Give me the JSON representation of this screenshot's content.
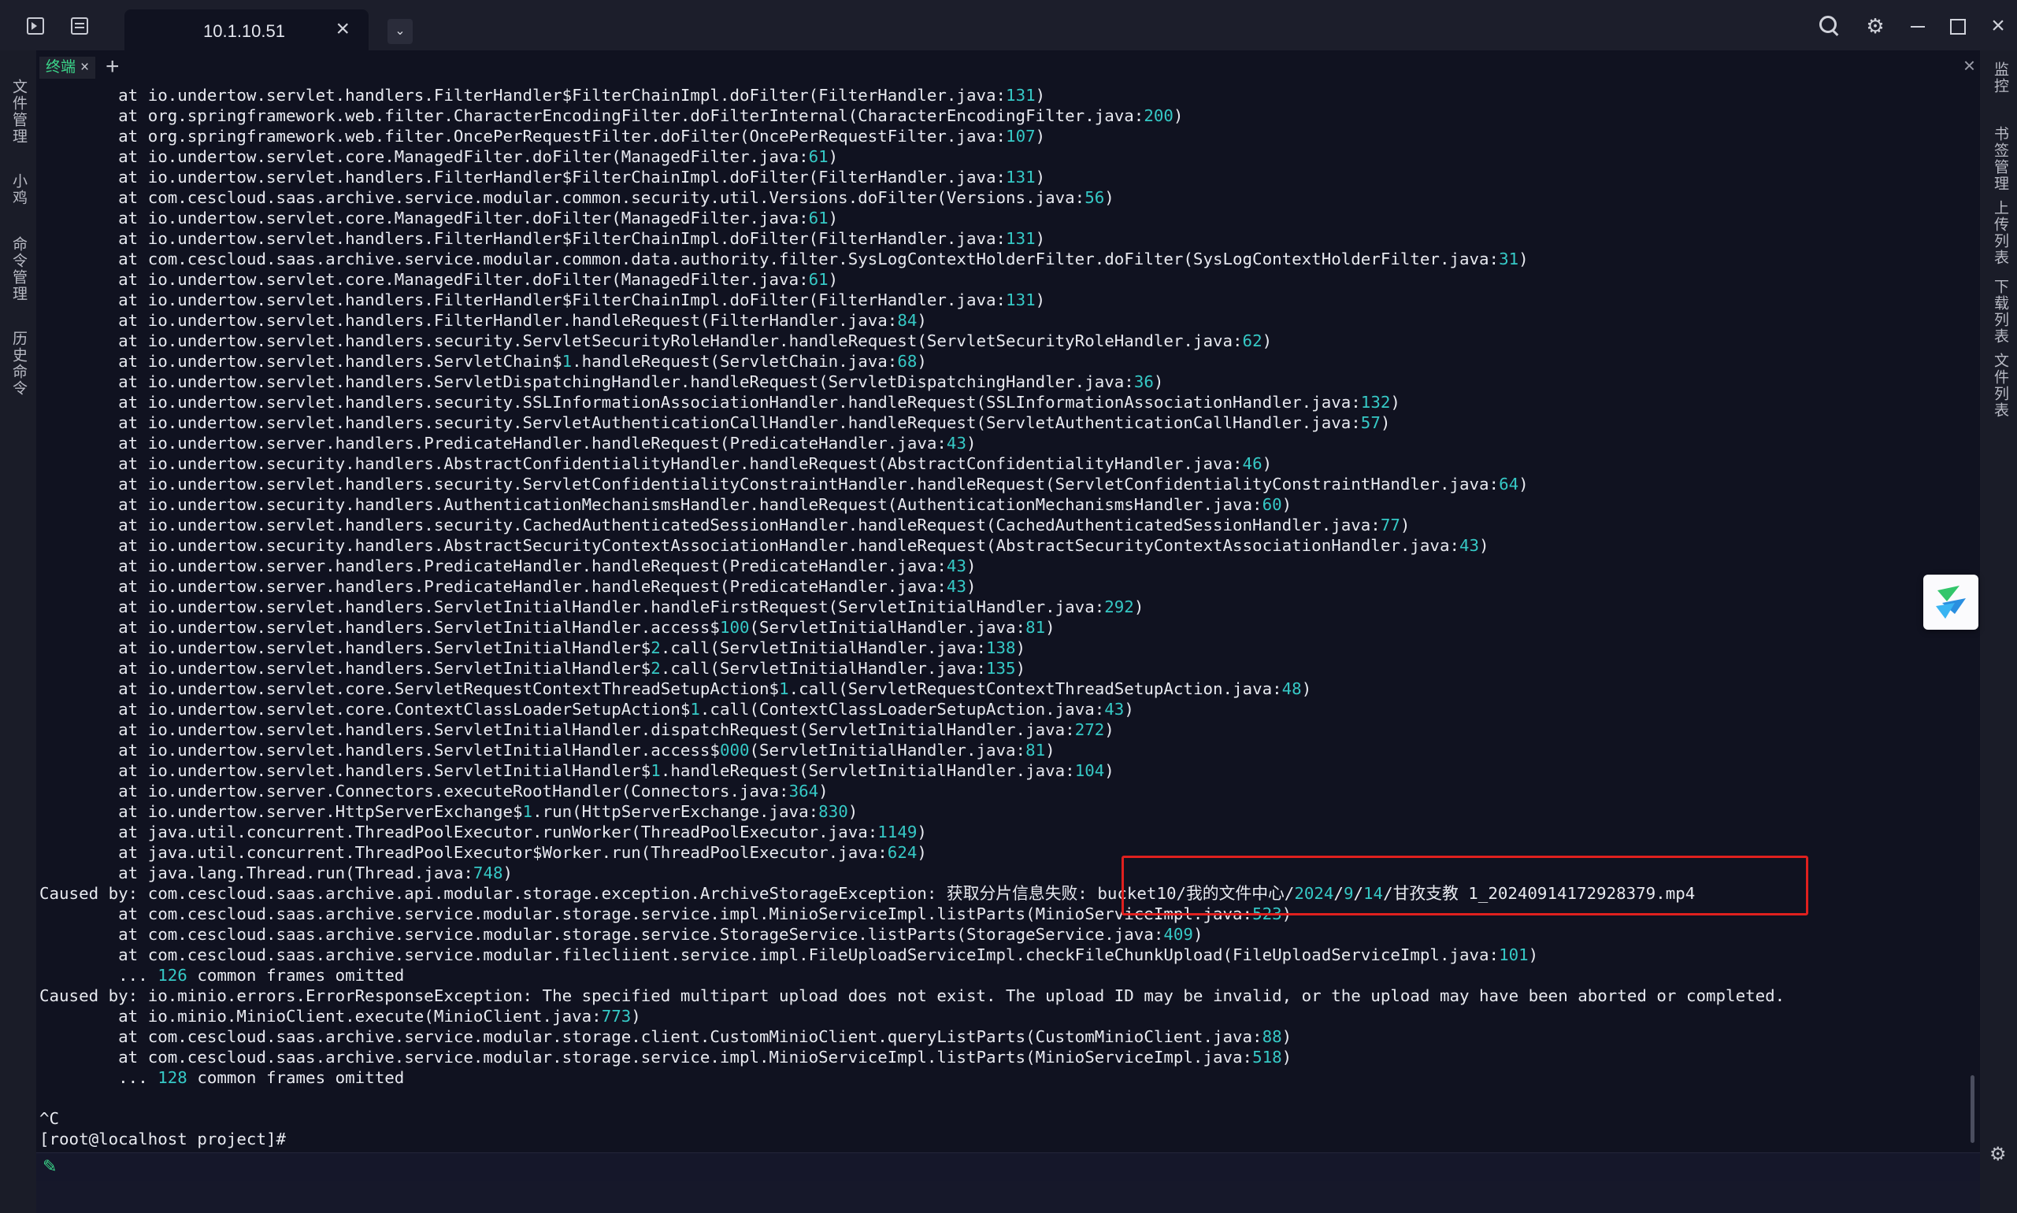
{
  "window": {
    "tab_title": "10.1.10.51"
  },
  "subtabs": {
    "terminal_tab_label": "终端"
  },
  "left_rail": [
    "文件管理",
    "小鸡",
    "命令管理",
    "历史命令"
  ],
  "right_rail": [
    "监控",
    "书签管理",
    "上传列表",
    "下载列表",
    "文件列表"
  ],
  "terminal": {
    "lines": [
      [
        [
          "        at io.undertow.servlet.handlers.FilterHandler$FilterChainImpl.doFilter(FilterHandler.java:",
          ""
        ],
        [
          "131",
          "n"
        ],
        [
          ")",
          ""
        ]
      ],
      [
        [
          "        at org.springframework.web.filter.CharacterEncodingFilter.doFilterInternal(CharacterEncodingFilter.java:",
          ""
        ],
        [
          "200",
          "n"
        ],
        [
          ")",
          ""
        ]
      ],
      [
        [
          "        at org.springframework.web.filter.OncePerRequestFilter.doFilter(OncePerRequestFilter.java:",
          ""
        ],
        [
          "107",
          "n"
        ],
        [
          ")",
          ""
        ]
      ],
      [
        [
          "        at io.undertow.servlet.core.ManagedFilter.doFilter(ManagedFilter.java:",
          ""
        ],
        [
          "61",
          "n"
        ],
        [
          ")",
          ""
        ]
      ],
      [
        [
          "        at io.undertow.servlet.handlers.FilterHandler$FilterChainImpl.doFilter(FilterHandler.java:",
          ""
        ],
        [
          "131",
          "n"
        ],
        [
          ")",
          ""
        ]
      ],
      [
        [
          "        at com.cescloud.saas.archive.service.modular.common.security.util.Versions.doFilter(Versions.java:",
          ""
        ],
        [
          "56",
          "n"
        ],
        [
          ")",
          ""
        ]
      ],
      [
        [
          "        at io.undertow.servlet.core.ManagedFilter.doFilter(ManagedFilter.java:",
          ""
        ],
        [
          "61",
          "n"
        ],
        [
          ")",
          ""
        ]
      ],
      [
        [
          "        at io.undertow.servlet.handlers.FilterHandler$FilterChainImpl.doFilter(FilterHandler.java:",
          ""
        ],
        [
          "131",
          "n"
        ],
        [
          ")",
          ""
        ]
      ],
      [
        [
          "        at com.cescloud.saas.archive.service.modular.common.data.authority.filter.SysLogContextHolderFilter.doFilter(SysLogContextHolderFilter.java:",
          ""
        ],
        [
          "31",
          "n"
        ],
        [
          ")",
          ""
        ]
      ],
      [
        [
          "        at io.undertow.servlet.core.ManagedFilter.doFilter(ManagedFilter.java:",
          ""
        ],
        [
          "61",
          "n"
        ],
        [
          ")",
          ""
        ]
      ],
      [
        [
          "        at io.undertow.servlet.handlers.FilterHandler$FilterChainImpl.doFilter(FilterHandler.java:",
          ""
        ],
        [
          "131",
          "n"
        ],
        [
          ")",
          ""
        ]
      ],
      [
        [
          "        at io.undertow.servlet.handlers.FilterHandler.handleRequest(FilterHandler.java:",
          ""
        ],
        [
          "84",
          "n"
        ],
        [
          ")",
          ""
        ]
      ],
      [
        [
          "        at io.undertow.servlet.handlers.security.ServletSecurityRoleHandler.handleRequest(ServletSecurityRoleHandler.java:",
          ""
        ],
        [
          "62",
          "n"
        ],
        [
          ")",
          ""
        ]
      ],
      [
        [
          "        at io.undertow.servlet.handlers.ServletChain$",
          ""
        ],
        [
          "1",
          "n"
        ],
        [
          ".handleRequest(ServletChain.java:",
          ""
        ],
        [
          "68",
          "n"
        ],
        [
          ")",
          ""
        ]
      ],
      [
        [
          "        at io.undertow.servlet.handlers.ServletDispatchingHandler.handleRequest(ServletDispatchingHandler.java:",
          ""
        ],
        [
          "36",
          "n"
        ],
        [
          ")",
          ""
        ]
      ],
      [
        [
          "        at io.undertow.servlet.handlers.security.SSLInformationAssociationHandler.handleRequest(SSLInformationAssociationHandler.java:",
          ""
        ],
        [
          "132",
          "n"
        ],
        [
          ")",
          ""
        ]
      ],
      [
        [
          "        at io.undertow.servlet.handlers.security.ServletAuthenticationCallHandler.handleRequest(ServletAuthenticationCallHandler.java:",
          ""
        ],
        [
          "57",
          "n"
        ],
        [
          ")",
          ""
        ]
      ],
      [
        [
          "        at io.undertow.server.handlers.PredicateHandler.handleRequest(PredicateHandler.java:",
          ""
        ],
        [
          "43",
          "n"
        ],
        [
          ")",
          ""
        ]
      ],
      [
        [
          "        at io.undertow.security.handlers.AbstractConfidentialityHandler.handleRequest(AbstractConfidentialityHandler.java:",
          ""
        ],
        [
          "46",
          "n"
        ],
        [
          ")",
          ""
        ]
      ],
      [
        [
          "        at io.undertow.servlet.handlers.security.ServletConfidentialityConstraintHandler.handleRequest(ServletConfidentialityConstraintHandler.java:",
          ""
        ],
        [
          "64",
          "n"
        ],
        [
          ")",
          ""
        ]
      ],
      [
        [
          "        at io.undertow.security.handlers.AuthenticationMechanismsHandler.handleRequest(AuthenticationMechanismsHandler.java:",
          ""
        ],
        [
          "60",
          "n"
        ],
        [
          ")",
          ""
        ]
      ],
      [
        [
          "        at io.undertow.servlet.handlers.security.CachedAuthenticatedSessionHandler.handleRequest(CachedAuthenticatedSessionHandler.java:",
          ""
        ],
        [
          "77",
          "n"
        ],
        [
          ")",
          ""
        ]
      ],
      [
        [
          "        at io.undertow.security.handlers.AbstractSecurityContextAssociationHandler.handleRequest(AbstractSecurityContextAssociationHandler.java:",
          ""
        ],
        [
          "43",
          "n"
        ],
        [
          ")",
          ""
        ]
      ],
      [
        [
          "        at io.undertow.server.handlers.PredicateHandler.handleRequest(PredicateHandler.java:",
          ""
        ],
        [
          "43",
          "n"
        ],
        [
          ")",
          ""
        ]
      ],
      [
        [
          "        at io.undertow.server.handlers.PredicateHandler.handleRequest(PredicateHandler.java:",
          ""
        ],
        [
          "43",
          "n"
        ],
        [
          ")",
          ""
        ]
      ],
      [
        [
          "        at io.undertow.servlet.handlers.ServletInitialHandler.handleFirstRequest(ServletInitialHandler.java:",
          ""
        ],
        [
          "292",
          "n"
        ],
        [
          ")",
          ""
        ]
      ],
      [
        [
          "        at io.undertow.servlet.handlers.ServletInitialHandler.access$",
          ""
        ],
        [
          "100",
          "n"
        ],
        [
          "(ServletInitialHandler.java:",
          ""
        ],
        [
          "81",
          "n"
        ],
        [
          ")",
          ""
        ]
      ],
      [
        [
          "        at io.undertow.servlet.handlers.ServletInitialHandler$",
          ""
        ],
        [
          "2",
          "n"
        ],
        [
          ".call(ServletInitialHandler.java:",
          ""
        ],
        [
          "138",
          "n"
        ],
        [
          ")",
          ""
        ]
      ],
      [
        [
          "        at io.undertow.servlet.handlers.ServletInitialHandler$",
          ""
        ],
        [
          "2",
          "n"
        ],
        [
          ".call(ServletInitialHandler.java:",
          ""
        ],
        [
          "135",
          "n"
        ],
        [
          ")",
          ""
        ]
      ],
      [
        [
          "        at io.undertow.servlet.core.ServletRequestContextThreadSetupAction$",
          ""
        ],
        [
          "1",
          "n"
        ],
        [
          ".call(ServletRequestContextThreadSetupAction.java:",
          ""
        ],
        [
          "48",
          "n"
        ],
        [
          ")",
          ""
        ]
      ],
      [
        [
          "        at io.undertow.servlet.core.ContextClassLoaderSetupAction$",
          ""
        ],
        [
          "1",
          "n"
        ],
        [
          ".call(ContextClassLoaderSetupAction.java:",
          ""
        ],
        [
          "43",
          "n"
        ],
        [
          ")",
          ""
        ]
      ],
      [
        [
          "        at io.undertow.servlet.handlers.ServletInitialHandler.dispatchRequest(ServletInitialHandler.java:",
          ""
        ],
        [
          "272",
          "n"
        ],
        [
          ")",
          ""
        ]
      ],
      [
        [
          "        at io.undertow.servlet.handlers.ServletInitialHandler.access$",
          ""
        ],
        [
          "000",
          "n"
        ],
        [
          "(ServletInitialHandler.java:",
          ""
        ],
        [
          "81",
          "n"
        ],
        [
          ")",
          ""
        ]
      ],
      [
        [
          "        at io.undertow.servlet.handlers.ServletInitialHandler$",
          ""
        ],
        [
          "1",
          "n"
        ],
        [
          ".handleRequest(ServletInitialHandler.java:",
          ""
        ],
        [
          "104",
          "n"
        ],
        [
          ")",
          ""
        ]
      ],
      [
        [
          "        at io.undertow.server.Connectors.executeRootHandler(Connectors.java:",
          ""
        ],
        [
          "364",
          "n"
        ],
        [
          ")",
          ""
        ]
      ],
      [
        [
          "        at io.undertow.server.HttpServerExchange$",
          ""
        ],
        [
          "1",
          "n"
        ],
        [
          ".run(HttpServerExchange.java:",
          ""
        ],
        [
          "830",
          "n"
        ],
        [
          ")",
          ""
        ]
      ],
      [
        [
          "        at java.util.concurrent.ThreadPoolExecutor.runWorker(ThreadPoolExecutor.java:",
          ""
        ],
        [
          "1149",
          "n"
        ],
        [
          ")",
          ""
        ]
      ],
      [
        [
          "        at java.util.concurrent.ThreadPoolExecutor$Worker.run(ThreadPoolExecutor.java:",
          ""
        ],
        [
          "624",
          "n"
        ],
        [
          ")",
          ""
        ]
      ],
      [
        [
          "        at java.lang.Thread.run(Thread.java:",
          ""
        ],
        [
          "748",
          "n"
        ],
        [
          ")",
          ""
        ]
      ],
      [
        [
          "Caused by: com.cescloud.saas.archive.api.modular.storage.exception.ArchiveStorageException: 获取分片信息失败: bucket10/我的文件中心/",
          ""
        ],
        [
          "2024",
          "n"
        ],
        [
          "/",
          ""
        ],
        [
          "9",
          "n"
        ],
        [
          "/",
          ""
        ],
        [
          "14",
          "n"
        ],
        [
          "/甘孜支教 1_20240914172928379.mp4",
          ""
        ]
      ],
      [
        [
          "        at com.cescloud.saas.archive.service.modular.storage.service.impl.MinioServiceImpl.listParts(MinioServiceImpl.java:",
          ""
        ],
        [
          "523",
          "n"
        ],
        [
          ")",
          ""
        ]
      ],
      [
        [
          "        at com.cescloud.saas.archive.service.modular.storage.service.StorageService.listParts(StorageService.java:",
          ""
        ],
        [
          "409",
          "n"
        ],
        [
          ")",
          ""
        ]
      ],
      [
        [
          "        at com.cescloud.saas.archive.service.modular.filecliient.service.impl.FileUploadServiceImpl.checkFileChunkUpload(FileUploadServiceImpl.java:",
          ""
        ],
        [
          "101",
          "n"
        ],
        [
          ")",
          ""
        ]
      ],
      [
        [
          "        ... ",
          ""
        ],
        [
          "126",
          "n"
        ],
        [
          " common frames omitted",
          ""
        ]
      ],
      [
        [
          "Caused by: io.minio.errors.ErrorResponseException: The specified multipart upload does not exist. The upload ID may be invalid, or the upload may have been aborted or completed.",
          ""
        ]
      ],
      [
        [
          "        at io.minio.MinioClient.execute(MinioClient.java:",
          ""
        ],
        [
          "773",
          "n"
        ],
        [
          ")",
          ""
        ]
      ],
      [
        [
          "        at com.cescloud.saas.archive.service.modular.storage.client.CustomMinioClient.queryListParts(CustomMinioClient.java:",
          ""
        ],
        [
          "88",
          "n"
        ],
        [
          ")",
          ""
        ]
      ],
      [
        [
          "        at com.cescloud.saas.archive.service.modular.storage.service.impl.MinioServiceImpl.listParts(MinioServiceImpl.java:",
          ""
        ],
        [
          "518",
          "n"
        ],
        [
          ")",
          ""
        ]
      ],
      [
        [
          "        ... ",
          ""
        ],
        [
          "128",
          "n"
        ],
        [
          " common frames omitted",
          ""
        ]
      ],
      [
        [
          "",
          ""
        ]
      ],
      [
        [
          "^C",
          ""
        ]
      ],
      [
        [
          "[root@localhost project]# ",
          ""
        ]
      ]
    ]
  }
}
